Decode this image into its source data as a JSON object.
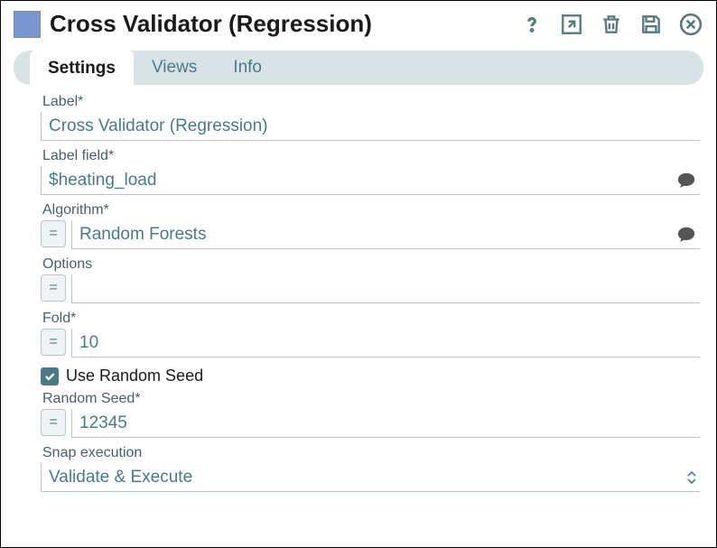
{
  "title": "Cross Validator (Regression)",
  "tabs": [
    {
      "label": "Settings",
      "active": true
    },
    {
      "label": "Views",
      "active": false
    },
    {
      "label": "Info",
      "active": false
    }
  ],
  "fields": {
    "label": {
      "label": "Label*",
      "value": "Cross Validator (Regression)"
    },
    "label_field": {
      "label": "Label field*",
      "value": "$heating_load"
    },
    "algorithm": {
      "label": "Algorithm*",
      "value": "Random Forests"
    },
    "options": {
      "label": "Options",
      "value": ""
    },
    "fold": {
      "label": "Fold*",
      "value": "10"
    },
    "use_random_seed": {
      "label": "Use Random Seed",
      "checked": true
    },
    "random_seed": {
      "label": "Random Seed*",
      "value": "12345"
    },
    "snap_execution": {
      "label": "Snap execution",
      "value": "Validate & Execute"
    }
  },
  "eq_symbol": "="
}
